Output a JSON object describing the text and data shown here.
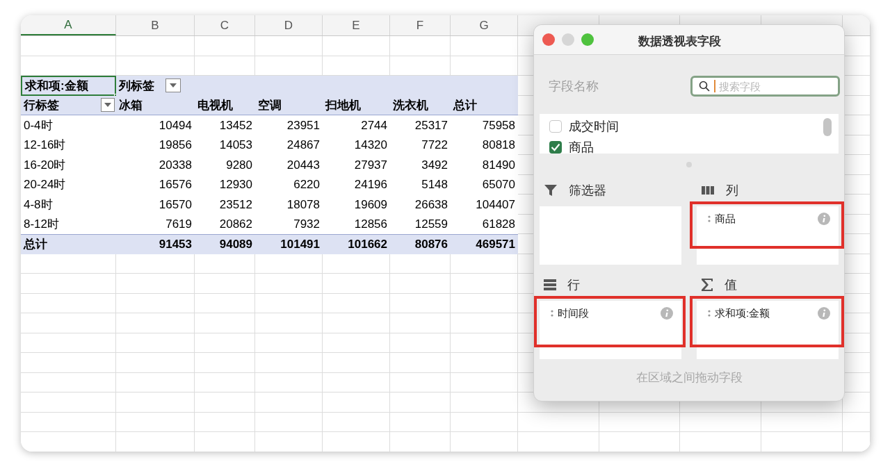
{
  "sheet": {
    "columns": [
      {
        "label": "A",
        "selected": true
      },
      {
        "label": "B",
        "selected": false
      },
      {
        "label": "C",
        "selected": false
      },
      {
        "label": "D",
        "selected": false
      },
      {
        "label": "E",
        "selected": false
      },
      {
        "label": "F",
        "selected": false
      },
      {
        "label": "G",
        "selected": false
      }
    ]
  },
  "pivot": {
    "value_label": "求和项:金额",
    "column_label": "列标签",
    "row_label": "行标签",
    "column_headers": [
      "冰箱",
      "电视机",
      "空调",
      "扫地机",
      "洗衣机",
      "总计"
    ],
    "rows": [
      {
        "label": "0-4时",
        "values": [
          "10494",
          "13452",
          "23951",
          "2744",
          "25317",
          "75958"
        ]
      },
      {
        "label": "12-16时",
        "values": [
          "19856",
          "14053",
          "24867",
          "14320",
          "7722",
          "80818"
        ]
      },
      {
        "label": "16-20时",
        "values": [
          "20338",
          "9280",
          "20443",
          "27937",
          "3492",
          "81490"
        ]
      },
      {
        "label": "20-24时",
        "values": [
          "16576",
          "12930",
          "6220",
          "24196",
          "5148",
          "65070"
        ]
      },
      {
        "label": "4-8时",
        "values": [
          "16570",
          "23512",
          "18078",
          "19609",
          "26638",
          "104407"
        ]
      },
      {
        "label": "8-12时",
        "values": [
          "7619",
          "20862",
          "7932",
          "12856",
          "12559",
          "61828"
        ]
      }
    ],
    "total": {
      "label": "总计",
      "values": [
        "91453",
        "94089",
        "101491",
        "101662",
        "80876",
        "469571"
      ]
    }
  },
  "panel": {
    "title": "数据透视表字段",
    "field_name_label": "字段名称",
    "search": {
      "placeholder": "搜索字段"
    },
    "fields": [
      {
        "label": "成交时间",
        "checked": false
      },
      {
        "label": "商品",
        "checked": true
      }
    ],
    "zones": [
      {
        "kind": "filter",
        "title": "筛选器",
        "highlighted": false
      },
      {
        "kind": "columns",
        "title": "列",
        "items": [
          "商品"
        ],
        "highlighted": true
      },
      {
        "kind": "rows",
        "title": "行",
        "items": [
          "时间段"
        ],
        "highlighted": true
      },
      {
        "kind": "values",
        "title": "值",
        "items": [
          "求和项:金额"
        ],
        "highlighted": true
      }
    ],
    "hint": "在区域之间拖动字段"
  }
}
